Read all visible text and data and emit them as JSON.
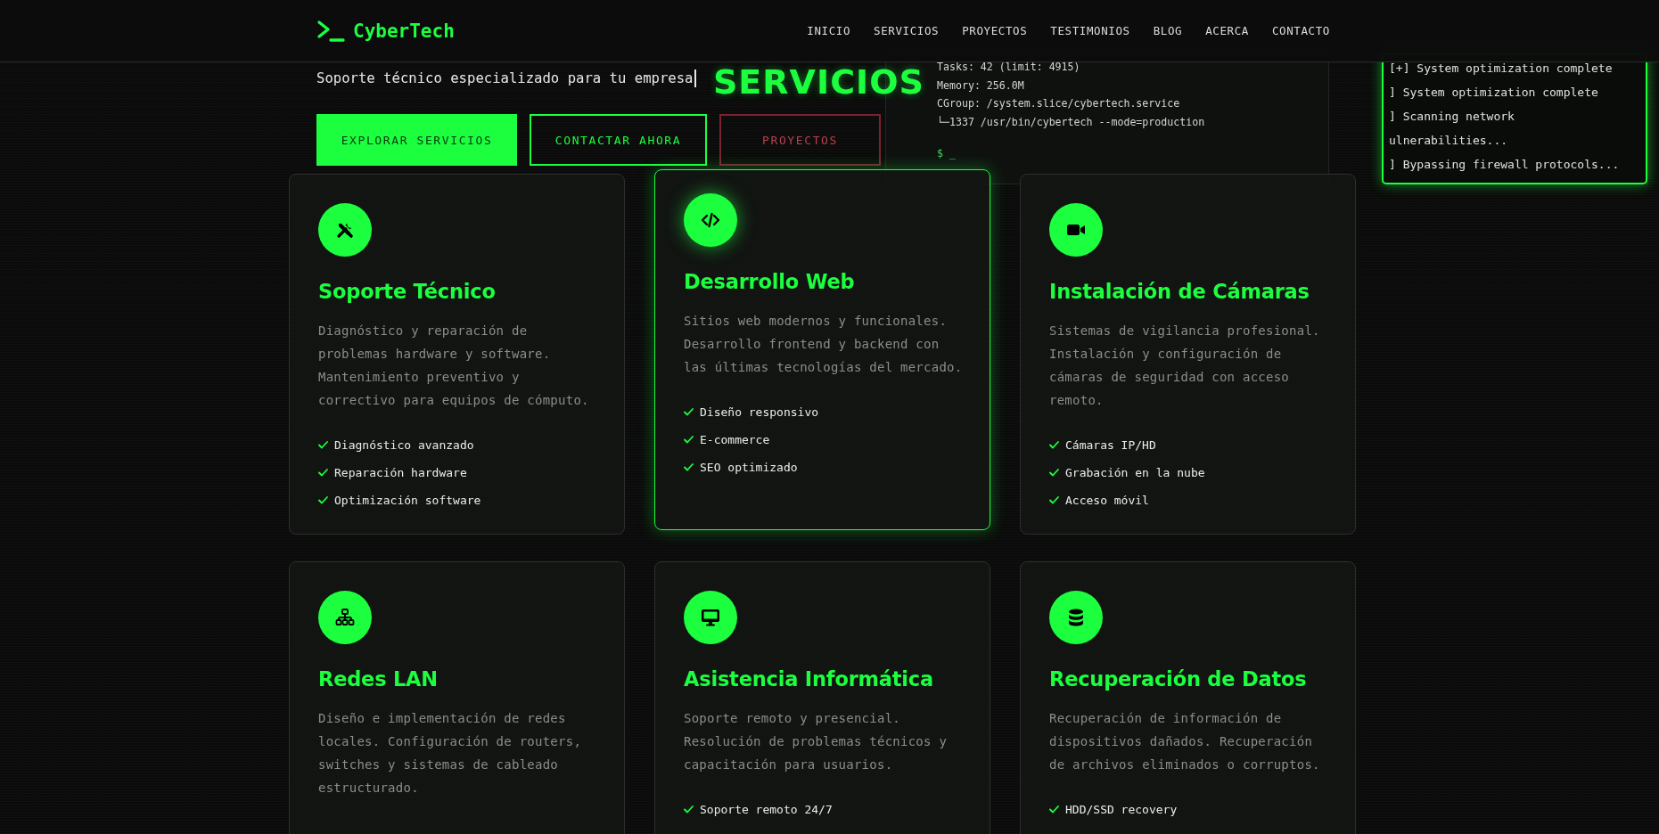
{
  "header": {
    "logo": "CyberTech",
    "nav": [
      {
        "label": "INICIO"
      },
      {
        "label": "SERVICIOS"
      },
      {
        "label": "PROYECTOS"
      },
      {
        "label": "TESTIMONIOS"
      },
      {
        "label": "BLOG"
      },
      {
        "label": "ACERCA"
      },
      {
        "label": "CONTACTO"
      }
    ]
  },
  "hero": {
    "subtitle": "Soporte técnico especializado para tu empresa",
    "buttons": [
      {
        "label": "EXPLORAR SERVICIOS",
        "kind": "primary"
      },
      {
        "label": "CONTACTAR AHORA",
        "kind": "outline"
      },
      {
        "label": "PROYECTOS",
        "kind": "danger"
      }
    ]
  },
  "terminal": {
    "lines": [
      "Tasks: 42 (limit: 4915)",
      "Memory: 256.0M",
      "CGroup: /system.slice/cybertech.service",
      "└─1337 /usr/bin/cybertech --mode=production"
    ],
    "prompt": "$ _"
  },
  "log": {
    "lines": [
      "[+] System optimization complete",
      "] System optimization complete",
      "] Scanning network",
      "ulnerabilities...",
      "] Bypassing firewall protocols..."
    ]
  },
  "section_title": "SERVICIOS",
  "services": [
    {
      "kind": "tools",
      "title": "Soporte Técnico",
      "description": "Diagnóstico y reparación de problemas hardware y software. Mantenimiento preventivo y correctivo para equipos de cómputo.",
      "features": [
        "Diagnóstico avanzado",
        "Reparación hardware",
        "Optimización software"
      ],
      "highlighted": false
    },
    {
      "kind": "code",
      "title": "Desarrollo Web",
      "description": "Sitios web modernos y funcionales. Desarrollo frontend y backend con las últimas tecnologías del mercado.",
      "features": [
        "Diseño responsivo",
        "E-commerce",
        "SEO optimizado"
      ],
      "highlighted": true
    },
    {
      "kind": "video",
      "title": "Instalación de Cámaras",
      "description": "Sistemas de vigilancia profesional. Instalación y configuración de cámaras de seguridad con acceso remoto.",
      "features": [
        "Cámaras IP/HD",
        "Grabación en la nube",
        "Acceso móvil"
      ],
      "highlighted": false
    },
    {
      "kind": "network",
      "title": "Redes LAN",
      "description": "Diseño e implementación de redes locales. Configuración de routers, switches y sistemas de cableado estructurado.",
      "highlighted": false
    },
    {
      "kind": "monitor",
      "title": "Asistencia Informática",
      "description": "Soporte remoto y presencial. Resolución de problemas técnicos y capacitación para usuarios.",
      "features": [
        "Soporte remoto 24/7"
      ],
      "highlighted": false
    },
    {
      "kind": "database",
      "title": "Recuperación de Datos",
      "description": "Recuperación de información de dispositivos dañados. Recuperación de archivos eliminados o corruptos.",
      "features": [
        "HDD/SSD recovery"
      ],
      "highlighted": false
    }
  ]
}
